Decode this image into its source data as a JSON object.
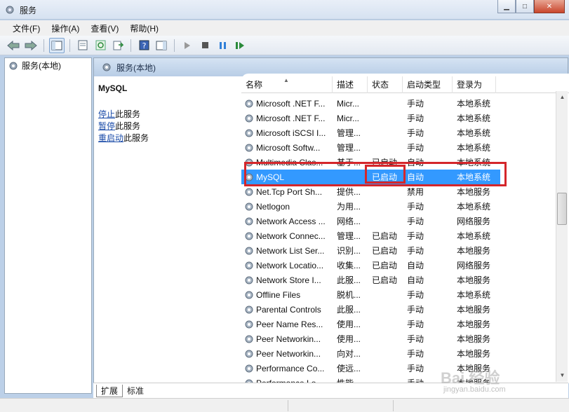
{
  "window": {
    "title": "服务"
  },
  "menu": [
    {
      "label": "文件(F)"
    },
    {
      "label": "操作(A)"
    },
    {
      "label": "查看(V)"
    },
    {
      "label": "帮助(H)"
    }
  ],
  "tree": {
    "item": "服务(本地)"
  },
  "pane": {
    "header": "服务(本地)"
  },
  "extended": {
    "service_name": "MySQL",
    "actions": [
      {
        "link": "停止",
        "suffix": "此服务"
      },
      {
        "link": "暂停",
        "suffix": "此服务"
      },
      {
        "link": "重启动",
        "suffix": "此服务"
      }
    ]
  },
  "columns": [
    "名称",
    "描述",
    "状态",
    "启动类型",
    "登录为"
  ],
  "services": [
    {
      "name": "Microsoft .NET F...",
      "desc": "Micr...",
      "status": "",
      "startup": "手动",
      "logon": "本地系统"
    },
    {
      "name": "Microsoft .NET F...",
      "desc": "Micr...",
      "status": "",
      "startup": "手动",
      "logon": "本地系统"
    },
    {
      "name": "Microsoft iSCSI I...",
      "desc": "管理...",
      "status": "",
      "startup": "手动",
      "logon": "本地系统"
    },
    {
      "name": "Microsoft Softw...",
      "desc": "管理...",
      "status": "",
      "startup": "手动",
      "logon": "本地系统"
    },
    {
      "name": "Multimedia Clas...",
      "desc": "基于...",
      "status": "已启动",
      "startup": "自动",
      "logon": "本地系统"
    },
    {
      "name": "MySQL",
      "desc": "",
      "status": "已启动",
      "startup": "自动",
      "logon": "本地系统"
    },
    {
      "name": "Net.Tcp Port Sh...",
      "desc": "提供...",
      "status": "",
      "startup": "禁用",
      "logon": "本地服务"
    },
    {
      "name": "Netlogon",
      "desc": "为用...",
      "status": "",
      "startup": "手动",
      "logon": "本地系统"
    },
    {
      "name": "Network Access ...",
      "desc": "网络...",
      "status": "",
      "startup": "手动",
      "logon": "网络服务"
    },
    {
      "name": "Network Connec...",
      "desc": "管理...",
      "status": "已启动",
      "startup": "手动",
      "logon": "本地系统"
    },
    {
      "name": "Network List Ser...",
      "desc": "识别...",
      "status": "已启动",
      "startup": "手动",
      "logon": "本地服务"
    },
    {
      "name": "Network Locatio...",
      "desc": "收集...",
      "status": "已启动",
      "startup": "自动",
      "logon": "网络服务"
    },
    {
      "name": "Network Store I...",
      "desc": "此服...",
      "status": "已启动",
      "startup": "自动",
      "logon": "本地服务"
    },
    {
      "name": "Offline Files",
      "desc": "脱机...",
      "status": "",
      "startup": "手动",
      "logon": "本地系统"
    },
    {
      "name": "Parental Controls",
      "desc": "此服...",
      "status": "",
      "startup": "手动",
      "logon": "本地服务"
    },
    {
      "name": "Peer Name Res...",
      "desc": "使用...",
      "status": "",
      "startup": "手动",
      "logon": "本地服务"
    },
    {
      "name": "Peer Networkin...",
      "desc": "使用...",
      "status": "",
      "startup": "手动",
      "logon": "本地服务"
    },
    {
      "name": "Peer Networkin...",
      "desc": "向对...",
      "status": "",
      "startup": "手动",
      "logon": "本地服务"
    },
    {
      "name": "Performance Co...",
      "desc": "使远...",
      "status": "",
      "startup": "手动",
      "logon": "本地服务"
    },
    {
      "name": "Performance Lo...",
      "desc": "性能...",
      "status": "",
      "startup": "手动",
      "logon": "本地服务"
    }
  ],
  "selected_index": 5,
  "tabs": [
    {
      "label": "扩展"
    },
    {
      "label": "标准"
    }
  ],
  "watermark": {
    "main": "Bai 经验",
    "sub": "jingyan.baidu.com"
  },
  "colors": {
    "selection": "#3399ff",
    "highlight_box": "#d4262b"
  }
}
